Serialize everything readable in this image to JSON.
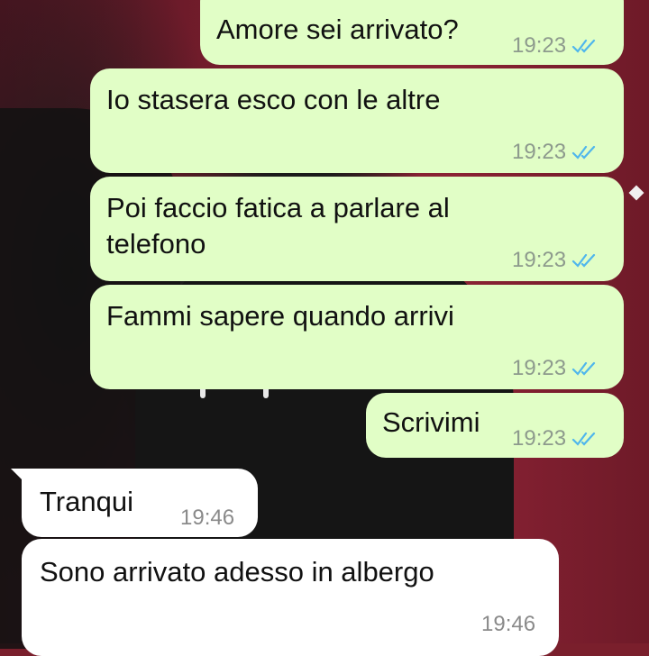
{
  "messages": [
    {
      "text": "Amore sei arrivato?",
      "time": "19:23"
    },
    {
      "text": "Io stasera esco con le altre",
      "time": "19:23"
    },
    {
      "text_line1": "Poi faccio fatica a parlare al",
      "text_line2": "telefono",
      "time": "19:23"
    },
    {
      "text": "Fammi sapere quando arrivi",
      "time": "19:23"
    },
    {
      "text": "Scrivimi",
      "time": "19:23"
    },
    {
      "text": "Tranqui",
      "time": "19:46"
    },
    {
      "text": "Sono arrivato adesso in albergo",
      "time": "19:46"
    }
  ],
  "icons": {
    "read_receipt": "double-check-icon"
  },
  "colors": {
    "outgoing_bubble": "#e1fec6",
    "incoming_bubble": "#ffffff",
    "read_tick": "#4fb6ec"
  }
}
